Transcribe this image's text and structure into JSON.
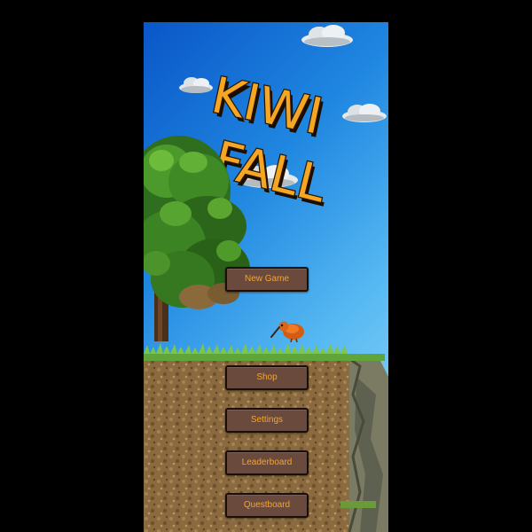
{
  "game": {
    "title_line1": "KIWI",
    "title_line2": "FALL"
  },
  "menu": {
    "new_game": "New Game",
    "shop": "Shop",
    "settings": "Settings",
    "leaderboard": "Leaderboard",
    "questboard": "Questboard"
  },
  "colors": {
    "button_bg": "#6b4a3e",
    "button_text": "#f4a52a",
    "title_fill": "#f5a623",
    "sky_top": "#0a56c8",
    "sky_bottom": "#a2dcf8"
  },
  "icons": [
    "cloud-icon",
    "tree-icon",
    "kiwi-bird-icon",
    "grass-icon",
    "dirt-ground-icon",
    "rock-cliff-icon"
  ]
}
